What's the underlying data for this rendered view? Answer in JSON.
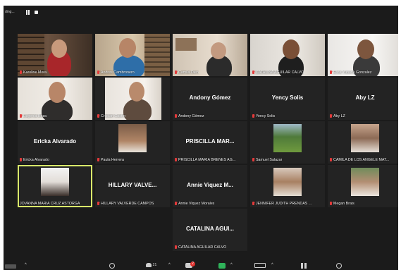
{
  "window": {
    "recording_label": "ding...",
    "participant_count": "21"
  },
  "participants": [
    {
      "name": "Karoline Mora"
    },
    {
      "name": "Andres Cambronero"
    },
    {
      "name": "Camila Dien"
    },
    {
      "name": "CATALINA AGUILAR CALVO"
    },
    {
      "name": "Elvia Yubank Gonzalez"
    },
    {
      "name": "Eugenia Boza"
    },
    {
      "name": "Cristian Castro"
    },
    {
      "name": "Andony Gómez",
      "display": "Andony Gómez"
    },
    {
      "name": "Yency Solis",
      "display": "Yency Solis"
    },
    {
      "name": "Aby LZ",
      "display": "Aby LZ"
    },
    {
      "name": "Ericka Alvarado",
      "display": "Ericka Alvarado"
    },
    {
      "name": "Paula Herrera"
    },
    {
      "name": "PRISCILLA MARIA BRENES AG...",
      "display": "PRISCILLA MAR..."
    },
    {
      "name": "Samuel Salazar"
    },
    {
      "name": "CAMILA DE LOS ANGELE MAT..."
    },
    {
      "name": "JOVANNA MARIA CRUZ ASTORGA"
    },
    {
      "name": "HILLARY VALVERDE CAMPOS",
      "display": "HILLARY VALVE..."
    },
    {
      "name": "Annie Viquez Morales",
      "display": "Annie Viquez M..."
    },
    {
      "name": "JENNIFER JUDITH PRENDAS ...",
      "display": ""
    },
    {
      "name": "Megan Brais"
    },
    {
      "name": "CATALINA AGUILAR CALVO",
      "display": "CATALINA AGUI..."
    }
  ],
  "colors": {
    "background": "#1b1b1b",
    "tile": "#232323",
    "active_speaker_border": "#d9e86a",
    "muted_icon": "#e33b3b",
    "notification_badge": "#e0302d"
  },
  "toolbar": {
    "chat_badge": "2"
  }
}
